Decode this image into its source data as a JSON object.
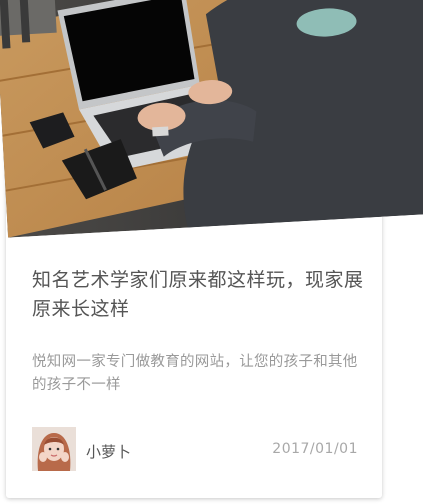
{
  "article": {
    "title": "知名艺术学家们原来都这样玩，现家展原来长这样",
    "description": "悦知网一家专门做教育的网站，让您的孩子和其他的孩子不一样",
    "author": "小萝卜",
    "date": "2017/01/01"
  },
  "icons": {
    "thumbnail": "laptop-desk-photo",
    "avatar": "author-avatar"
  }
}
